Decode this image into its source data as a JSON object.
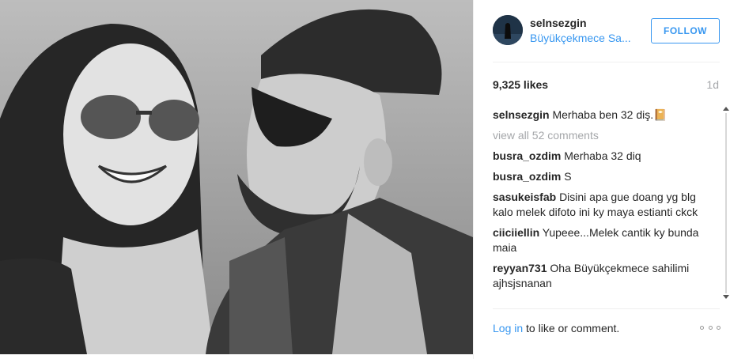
{
  "photo": {
    "description_icon": "photo-icon"
  },
  "header": {
    "username": "selnsezgin",
    "location": "Büyükçekmece Sa...",
    "follow_label": "FOLLOW"
  },
  "stats": {
    "likes": "9,325 likes",
    "age": "1d"
  },
  "caption": {
    "user": "selnsezgin",
    "text": "Merhaba ben 32 diş.📔"
  },
  "view_all": "view all 52 comments",
  "comments": [
    {
      "user": "busra_ozdim",
      "text": "Merhaba 32 diq"
    },
    {
      "user": "busra_ozdim",
      "text": "S"
    },
    {
      "user": "sasukeisfab",
      "text": "Disini apa gue doang yg blg kalo melek difoto ini ky maya estianti ckck"
    },
    {
      "user": "ciiciiellin",
      "text": "Yupeee...Melek cantik ky bunda maia"
    },
    {
      "user": "reyyan731",
      "text": "Oha Büyükçekmece sahilimi ajhsjsnanan"
    }
  ],
  "footer": {
    "login_link": "Log in",
    "login_rest": " to like or comment."
  },
  "colors": {
    "accent": "#3897f0",
    "muted": "#a5a7aa",
    "text": "#262626"
  }
}
